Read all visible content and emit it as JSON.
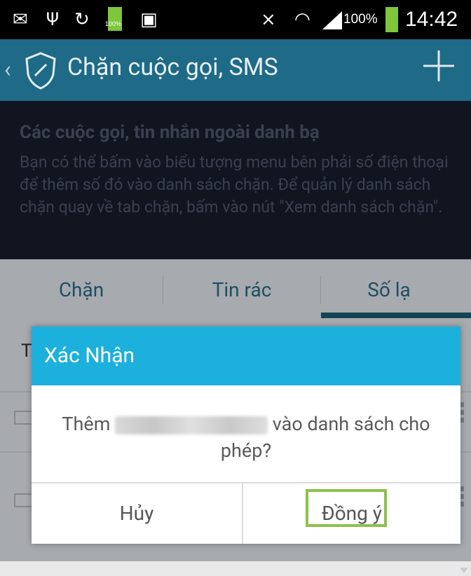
{
  "status_bar": {
    "time": "14:42",
    "battery_percent": "100%",
    "battery_small_label": "100%",
    "icons": [
      "mail-icon",
      "usb-icon",
      "sync-icon",
      "battery-charging-icon",
      "store-bag-icon",
      "mute-icon",
      "wifi-icon",
      "signal-icon",
      "battery-icon"
    ]
  },
  "app_bar": {
    "title": "Chặn cuộc gọi, SMS",
    "back_icon": "chevron-left-icon",
    "logo_icon": "shield-icon",
    "action_icon": "plus-icon"
  },
  "info": {
    "title": "Các cuộc gọi, tin nhắn ngoài danh bạ",
    "body": "Bạn có thể bấm vào biểu tượng menu bên phải số điện thoại để thêm số đó vào danh sách chặn. Để quản lý danh sách chặn quay về tab chặn, bấm vào nút \"Xem danh sách chặn\"."
  },
  "tabs": [
    {
      "label": "Chặn"
    },
    {
      "label": "Tin rác"
    },
    {
      "label": "Số lạ",
      "selected": true
    }
  ],
  "list": {
    "partial_header": "T"
  },
  "dialog": {
    "title": "Xác Nhận",
    "message_prefix": "Thêm",
    "message_suffix": "vào danh sách cho phép?",
    "cancel_label": "Hủy",
    "confirm_label": "Đồng ý"
  },
  "colors": {
    "app_bar": "#1f6a86",
    "dialog_header": "#1cb0dc",
    "highlight": "#8bc34a"
  }
}
